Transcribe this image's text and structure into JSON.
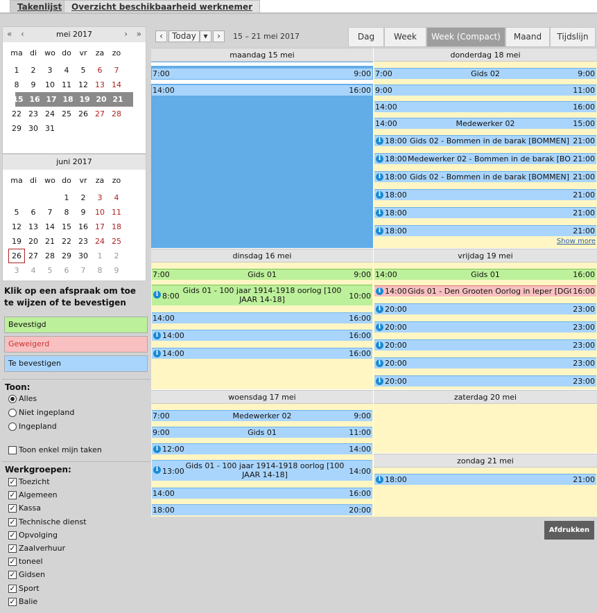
{
  "top_tabs": [
    "Takenlijst",
    "Overzicht beschikbaarheid werknemer"
  ],
  "mini_cal_may": {
    "title": "mei 2017",
    "weekdays": [
      "ma",
      "di",
      "wo",
      "do",
      "vr",
      "za",
      "zo"
    ],
    "weeks": [
      [
        "1",
        "2",
        "3",
        "4",
        "5",
        "6",
        "7"
      ],
      [
        "8",
        "9",
        "10",
        "11",
        "12",
        "13",
        "14"
      ],
      [
        "15",
        "16",
        "17",
        "18",
        "19",
        "20",
        "21"
      ],
      [
        "22",
        "23",
        "24",
        "25",
        "26",
        "27",
        "28"
      ],
      [
        "29",
        "30",
        "31",
        "",
        "",
        "",
        ""
      ]
    ]
  },
  "mini_cal_june": {
    "title": "juni 2017",
    "weekdays": [
      "ma",
      "di",
      "wo",
      "do",
      "vr",
      "za",
      "zo"
    ],
    "weeks": [
      [
        "",
        "",
        "",
        "1",
        "2",
        "3",
        "4"
      ],
      [
        "5",
        "6",
        "7",
        "8",
        "9",
        "10",
        "11"
      ],
      [
        "12",
        "13",
        "14",
        "15",
        "16",
        "17",
        "18"
      ],
      [
        "19",
        "20",
        "21",
        "22",
        "23",
        "24",
        "25"
      ],
      [
        "26",
        "27",
        "28",
        "29",
        "30",
        "1",
        "2"
      ],
      [
        "3",
        "4",
        "5",
        "6",
        "7",
        "8",
        "9"
      ]
    ]
  },
  "hint": "Klik op een afspraak om toe te wijzen of te bevestigen",
  "legend": {
    "confirmed": "Bevestigd",
    "refused": "Geweigerd",
    "pending": "Te bevestigen"
  },
  "colors": {
    "confirmed": "#bdf09b",
    "refused": "#f8c0c0",
    "pending": "#a9d5fc",
    "weekend": "#b02020"
  },
  "show": {
    "title": "Toon:",
    "options": [
      "Alles",
      "Niet ingepland",
      "Ingepland"
    ],
    "selected": "Alles",
    "only_mine": "Toon enkel mijn taken"
  },
  "workgroups": {
    "title": "Werkgroepen:",
    "items": [
      "Toezicht",
      "Algemeen",
      "Kassa",
      "Technische dienst",
      "Opvolging",
      "Zaalverhuur",
      "toneel",
      "Gidsen",
      "Sport",
      "Balie"
    ]
  },
  "toolbar": {
    "prev": "‹",
    "today": "Today",
    "dropdown": "▾",
    "next": "›",
    "range": "15 – 21 mei 2017"
  },
  "views": [
    "Dag",
    "Week",
    "Week (Compact)",
    "Maand",
    "Tijdslijn"
  ],
  "active_view": "Week (Compact)",
  "days": {
    "mon": {
      "title": "maandag 15 mei",
      "events": [
        {
          "start": "7:00",
          "end": "9:00",
          "title": "",
          "color": "blue"
        },
        {
          "start": "14:00",
          "end": "16:00",
          "title": "",
          "color": "blue"
        }
      ]
    },
    "tue": {
      "title": "dinsdag 16 mei",
      "events": [
        {
          "start": "7:00",
          "end": "9:00",
          "title": "Gids 01",
          "color": "green"
        },
        {
          "start": "8:00",
          "end": "10:00",
          "title": "Gids 01 - 100 jaar 1914-1918 oorlog [100 JAAR 14-18]",
          "color": "green",
          "info": true
        },
        {
          "start": "14:00",
          "end": "16:00",
          "title": "",
          "color": "blue"
        },
        {
          "start": "14:00",
          "end": "16:00",
          "title": "",
          "color": "blue",
          "info": true
        },
        {
          "start": "14:00",
          "end": "16:00",
          "title": "",
          "color": "blue",
          "info": true
        }
      ]
    },
    "wed": {
      "title": "woensdag 17 mei",
      "events": [
        {
          "start": "7:00",
          "end": "9:00",
          "title": "Medewerker 02",
          "color": "blue"
        },
        {
          "start": "9:00",
          "end": "11:00",
          "title": "Gids 01",
          "color": "blue"
        },
        {
          "start": "12:00",
          "end": "14:00",
          "title": "",
          "color": "blue",
          "info": true
        },
        {
          "start": "13:00",
          "end": "14:00",
          "title": "Gids 01 - 100 jaar 1914-1918 oorlog [100 JAAR 14-18]",
          "color": "blue",
          "info": true
        },
        {
          "start": "14:00",
          "end": "16:00",
          "title": "",
          "color": "blue"
        },
        {
          "start": "18:00",
          "end": "20:00",
          "title": "",
          "color": "blue"
        }
      ]
    },
    "thu": {
      "title": "donderdag 18 mei",
      "events": [
        {
          "start": "7:00",
          "end": "9:00",
          "title": "Gids 02",
          "color": "blue"
        },
        {
          "start": "9:00",
          "end": "11:00",
          "title": "",
          "color": "blue"
        },
        {
          "start": "14:00",
          "end": "16:00",
          "title": "",
          "color": "blue"
        },
        {
          "start": "14:00",
          "end": "15:00",
          "title": "Medewerker 02",
          "color": "blue"
        },
        {
          "start": "18:00",
          "end": "21:00",
          "title": "Gids 02 - Bommen in de barak [BOMMEN]",
          "color": "blue",
          "info": true
        },
        {
          "start": "18:00",
          "end": "21:00",
          "title": "Medewerker 02 - Bommen in de barak [BOMMEN]",
          "color": "blue",
          "info": true
        },
        {
          "start": "18:00",
          "end": "21:00",
          "title": "Gids 02 - Bommen in de barak [BOMMEN]",
          "color": "blue",
          "info": true
        },
        {
          "start": "18:00",
          "end": "21:00",
          "title": "",
          "color": "blue",
          "info": true
        },
        {
          "start": "18:00",
          "end": "21:00",
          "title": "",
          "color": "blue",
          "info": true
        },
        {
          "start": "18:00",
          "end": "21:00",
          "title": "",
          "color": "blue",
          "info": true
        }
      ],
      "more": "Show more"
    },
    "fri": {
      "title": "vrijdag 19 mei",
      "events": [
        {
          "start": "14:00",
          "end": "16:00",
          "title": "Gids 01",
          "color": "green"
        },
        {
          "start": "14:00",
          "end": "16:00",
          "title": "Gids 01 - Den Grooten Oorlog in Ieper [DGO]",
          "color": "red",
          "info": true
        },
        {
          "start": "20:00",
          "end": "23:00",
          "title": "",
          "color": "blue",
          "info": true
        },
        {
          "start": "20:00",
          "end": "23:00",
          "title": "",
          "color": "blue",
          "info": true
        },
        {
          "start": "20:00",
          "end": "23:00",
          "title": "",
          "color": "blue",
          "info": true
        },
        {
          "start": "20:00",
          "end": "23:00",
          "title": "",
          "color": "blue",
          "info": true
        },
        {
          "start": "20:00",
          "end": "23:00",
          "title": "",
          "color": "blue",
          "info": true
        }
      ]
    },
    "sat": {
      "title": "zaterdag 20 mei",
      "events": []
    },
    "sun": {
      "title": "zondag 21 mei",
      "events": [
        {
          "start": "18:00",
          "end": "21:00",
          "title": "",
          "color": "blue",
          "info": true
        }
      ]
    }
  },
  "print": "Afdrukken"
}
